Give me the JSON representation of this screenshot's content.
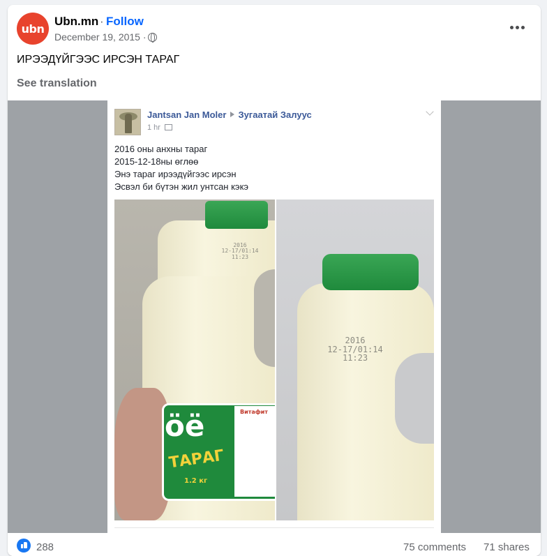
{
  "post": {
    "page_name": "Ubn.mn",
    "separator": "·",
    "follow_label": "Follow",
    "date": "December 19, 2015 ·",
    "avatar_text": "ubn",
    "text": "ИРЭЭДҮЙГЭЭС ИРСЭН ТАРАГ",
    "see_translation": "See translation",
    "icons": [
      "globe-icon",
      "more-icon"
    ]
  },
  "shared_post": {
    "author": "Jantsan Jan Moler",
    "group": "Зугаатай Залуус",
    "time": "1 hr",
    "lines": [
      "2016 оны анхны тараг",
      "2015-12-18ны өглөө",
      "Энэ тараг ирээдүйгээс ирсэн",
      "Эсвэл би бүтэн жил унтсан кэкэ"
    ],
    "photo_left_print": [
      "2016",
      "12-17/01:14",
      "11:23"
    ],
    "photo_right_print": [
      "2016",
      "12-17/01:14",
      "11:23"
    ],
    "label_brand": "Витафит",
    "label_big": "ӧё",
    "label_product": "ТАРАГ",
    "label_volume": "1.2 кг"
  },
  "footer": {
    "likes": "288",
    "comments": "75 comments",
    "shares": "71 shares"
  },
  "colors": {
    "accent": "#0866ff",
    "avatar_bg": "#e8432d",
    "label_green": "#1f8a3c"
  }
}
